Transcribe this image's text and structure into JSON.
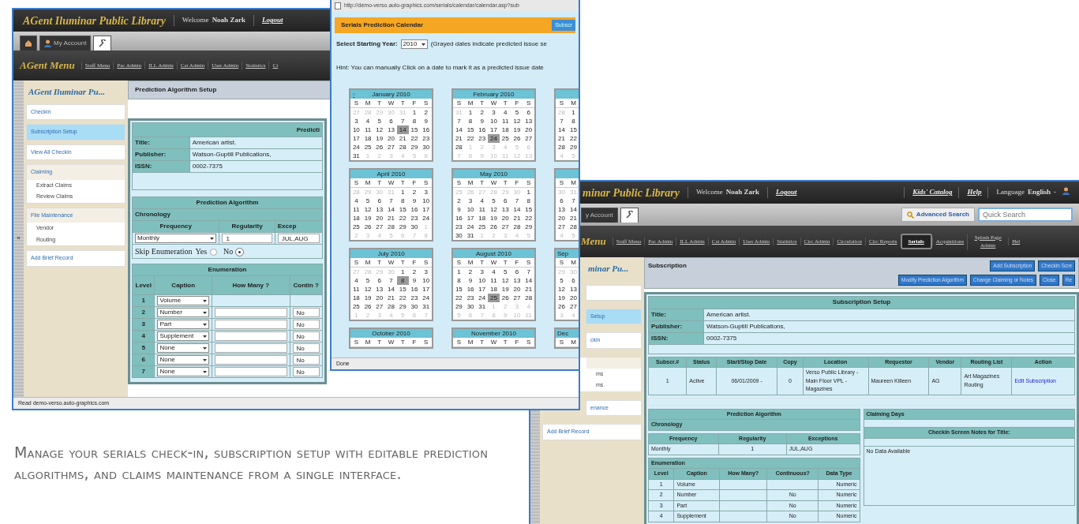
{
  "main_window": {
    "header": {
      "library": "AGent Iluminar Public Library",
      "welcome": "Welcome",
      "user": "Noah Zark",
      "logout": "Logout"
    },
    "tabs": [
      {
        "kind": "home",
        "selected": false
      },
      {
        "kind": "account",
        "label": "My Account",
        "selected": false
      },
      {
        "kind": "tools",
        "selected": true
      }
    ],
    "menu": {
      "title": "AGent Menu",
      "items": [
        "Staff Menu",
        "Pac Admin",
        "ILL Admin",
        "Cat Admin",
        "User Admin",
        "Statistics",
        "Ci"
      ]
    },
    "expand_arrow": "»",
    "sidebar": {
      "title": "AGent Iluminar Pu...",
      "items": [
        {
          "label": "Checkin",
          "selected": false
        },
        {
          "label": "Subscription Setup",
          "selected": true
        },
        {
          "label": "View All Checkin",
          "selected": false
        },
        {
          "label": "Claiming",
          "selected": false,
          "children": [
            "Extract Claims",
            "Review Claims"
          ]
        },
        {
          "label": "File Maintenance",
          "selected": false,
          "children": [
            "Vendor",
            "Routing"
          ]
        },
        {
          "label": "Add Brief Record",
          "selected": false
        }
      ]
    },
    "page_title": "Prediction Algorithm Setup",
    "title_table": {
      "heading": "Predicti",
      "rows": [
        {
          "label": "Title:",
          "value": "American artist."
        },
        {
          "label": "Publisher:",
          "value": "Watson-Guptill Publications,"
        },
        {
          "label": "ISSN:",
          "value": "0002-7375"
        }
      ]
    },
    "algorithm": {
      "heading": "Prediction Algorithm",
      "chronology": "Chronology",
      "columns": [
        "Frequency",
        "Regularity",
        "Excep"
      ],
      "frequency": "Monthly",
      "regularity": "1",
      "exceptions": "JUL,AUG",
      "skip_label": "Skip Enumeration",
      "options": [
        {
          "label": "Yes",
          "selected": false
        },
        {
          "label": "No",
          "selected": true
        }
      ]
    },
    "enumeration": {
      "heading": "Enumeration",
      "columns": [
        "Level",
        "Caption",
        "How Many ?",
        "Contin ?"
      ],
      "rows": [
        {
          "level": "1",
          "caption": "Volume"
        },
        {
          "level": "2",
          "caption": "Number",
          "continuous": "No"
        },
        {
          "level": "3",
          "caption": "Part",
          "continuous": "No"
        },
        {
          "level": "4",
          "caption": "Supplement",
          "continuous": "No"
        },
        {
          "level": "5",
          "caption": "None",
          "continuous": "No"
        },
        {
          "level": "6",
          "caption": "None",
          "continuous": "No"
        },
        {
          "level": "7",
          "caption": "None",
          "continuous": "No"
        }
      ]
    },
    "status": "Read demo-verso.auto-graphics.com"
  },
  "calendar_popup": {
    "url": "http://demo-verso.auto-graphics.com/serials/calendar/calendar.asp?sub",
    "title": "Serials Prediction Calendar",
    "title_button": "Subscr",
    "year_label": "Select Starting Year:",
    "year": "2010",
    "legend": "(Grayed dates indicate predicted issue se",
    "hint": "Hint: You can manually Click on a date to mark it as a predicted issue date",
    "months": [
      {
        "title": "January 2010",
        "prev": "‹",
        "weekdays": [
          "S",
          "M",
          "T",
          "W",
          "T",
          "F",
          "S"
        ],
        "lead": [
          "27",
          "28",
          "29",
          "30",
          "31"
        ],
        "days": [
          "1",
          "2",
          "3",
          "4",
          "5",
          "6",
          "7",
          "8",
          "9",
          "10",
          "11",
          "12",
          "13",
          {
            "day": "14",
            "marked": true
          },
          "15",
          "16",
          "17",
          "18",
          "19",
          "20",
          "21",
          "22",
          "23",
          "24",
          "25",
          "26",
          "27",
          "28",
          "29",
          "30",
          "31"
        ],
        "trail": [
          "1",
          "2",
          "3",
          "4",
          "5",
          "6"
        ]
      },
      {
        "title": "February 2010",
        "weekdays": [
          "S",
          "M",
          "T",
          "W",
          "T",
          "F",
          "S"
        ],
        "lead": [
          "31"
        ],
        "days": [
          "1",
          "2",
          "3",
          "4",
          "5",
          "6",
          "7",
          "8",
          "9",
          "10",
          "11",
          "12",
          "13",
          "14",
          "15",
          "16",
          "17",
          "18",
          "19",
          "20",
          "21",
          "22",
          "23",
          {
            "day": "24",
            "marked": true
          },
          "25",
          "26",
          "27",
          "28"
        ],
        "trail": [
          "1",
          "2",
          "3",
          "4",
          "5",
          "6",
          "7",
          "8",
          "9",
          "10",
          "11",
          "12",
          "13"
        ]
      },
      {
        "weekdays": [
          "S",
          "M"
        ],
        "lead": [
          "28"
        ],
        "days": [
          "1",
          "7",
          "8",
          "14",
          "15",
          "21",
          "22",
          "28",
          "29"
        ],
        "trail": [
          "4",
          "5"
        ]
      },
      {
        "title": "April 2010",
        "weekdays": [
          "S",
          "M",
          "T",
          "W",
          "T",
          "F",
          "S"
        ],
        "lead": [
          "28",
          "29",
          "30",
          "31"
        ],
        "days": [
          "1",
          "2",
          "3",
          "4",
          "5",
          "6",
          "7",
          "8",
          "9",
          "10",
          "11",
          "12",
          "13",
          "14",
          "15",
          "16",
          "17",
          "18",
          "19",
          "20",
          "21",
          "22",
          "23",
          "24",
          "25",
          "26",
          "27",
          "28",
          "29",
          "30"
        ],
        "trail": [
          "1",
          "2",
          "3",
          "4",
          "5",
          "6",
          "7",
          "8"
        ]
      },
      {
        "title": "May 2010",
        "weekdays": [
          "S",
          "M",
          "T",
          "W",
          "T",
          "F",
          "S"
        ],
        "lead": [
          "25",
          "26",
          "27",
          "28",
          "29",
          "30"
        ],
        "days": [
          "1",
          "2",
          "3",
          "4",
          "5",
          "6",
          "7",
          "8",
          "9",
          "10",
          "11",
          "12",
          "13",
          "14",
          "15",
          "16",
          "17",
          "18",
          "19",
          "20",
          "21",
          "22",
          "23",
          "24",
          "25",
          "26",
          "27",
          "28",
          "29",
          "30",
          "31"
        ],
        "trail": [
          "1",
          "2",
          "3",
          "4",
          "5"
        ]
      },
      {
        "weekdays": [
          "S",
          "M"
        ],
        "lead": [
          "30",
          "31"
        ],
        "days": [
          "6",
          "7",
          "13",
          "14",
          "20",
          "21",
          "27",
          "28"
        ],
        "trail": [
          "4",
          "5"
        ]
      },
      {
        "title": "July 2010",
        "weekdays": [
          "S",
          "M",
          "T",
          "W",
          "T",
          "F",
          "S"
        ],
        "lead": [
          "27",
          "28",
          "29",
          "30"
        ],
        "days": [
          "1",
          "2",
          "3",
          "4",
          "5",
          "6",
          "7",
          {
            "day": "8",
            "marked": true
          },
          "9",
          "10",
          "11",
          "12",
          "13",
          "14",
          "15",
          "16",
          "17",
          "18",
          "19",
          "20",
          "21",
          "22",
          "23",
          "24",
          "25",
          "26",
          "27",
          "28",
          "29",
          "30",
          "31"
        ],
        "trail": [
          "1",
          "2",
          "3",
          "4",
          "5",
          "6",
          "7"
        ]
      },
      {
        "title": "August 2010",
        "weekdays": [
          "S",
          "M",
          "T",
          "W",
          "T",
          "F",
          "S"
        ],
        "days": [
          "1",
          "2",
          "3",
          "4",
          "5",
          "6",
          "7",
          "8",
          "9",
          "10",
          "11",
          "12",
          "13",
          "14",
          "15",
          "16",
          "17",
          "18",
          "19",
          "20",
          "21",
          "22",
          "23",
          "24",
          {
            "day": "25",
            "marked": true
          },
          "26",
          "27",
          "28",
          "29",
          "30",
          "31"
        ],
        "trail": [
          "1",
          "2",
          "3",
          "4",
          "5",
          "6",
          "7",
          "8",
          "9",
          "10",
          "11"
        ]
      },
      {
        "title": "Sep",
        "weekdays": [
          "S",
          "M"
        ],
        "lead": [
          "29",
          "30"
        ],
        "days": [
          "5",
          "6",
          "12",
          "13",
          "19",
          "20",
          "26",
          "27"
        ],
        "trail": [
          "3",
          "4"
        ]
      },
      {
        "title": "October 2010",
        "weekdays": [
          "S",
          "M",
          "T",
          "W",
          "T",
          "F",
          "S"
        ]
      },
      {
        "title": "November 2010",
        "weekdays": [
          "S",
          "M",
          "T",
          "W",
          "T",
          "F",
          "S"
        ]
      },
      {
        "title": "Dec",
        "weekdays": [
          "S",
          "M"
        ]
      }
    ],
    "status": "Done"
  },
  "subscription_window": {
    "header": {
      "library": "minar Public Library",
      "welcome": "Welcome",
      "user": "Noah Zark",
      "logout": "Logout",
      "links": [
        "Kids' Catalog",
        "Help"
      ],
      "language_label": "Language",
      "language": "English",
      "language_caret": "-"
    },
    "account_tab": "y Account",
    "advanced_search": "Advanced Search",
    "quick_search": {
      "placeholder": "Quick Search"
    },
    "menu": {
      "title": "Menu",
      "items": [
        {
          "label": "Staff Menu",
          "selected": false
        },
        {
          "label": "Pac Admin",
          "selected": false
        },
        {
          "label": "ILL Admin",
          "selected": false
        },
        {
          "label": "Cat Admin",
          "selected": false
        },
        {
          "label": "User Admin",
          "selected": false
        },
        {
          "label": "Statistics",
          "selected": false
        },
        {
          "label": "Circ Admin",
          "selected": false
        },
        {
          "label": "Circulation",
          "selected": false
        },
        {
          "label": "Circ Reports",
          "selected": false
        },
        {
          "label": "Serials",
          "selected": true
        },
        {
          "label": "Acquisitions",
          "selected": false
        },
        {
          "label": "Splash Page Admin",
          "selected": false
        },
        {
          "label": "Hel",
          "selected": false
        }
      ]
    },
    "sidebar": {
      "title": "minar Pu...",
      "items": [
        {
          "selected": false
        },
        {
          "label": "Setup",
          "selected": true
        },
        {
          "label": "ckin",
          "selected": false
        },
        {
          "selected": false,
          "children": [
            "ms",
            "ms"
          ]
        },
        {
          "label": "enance",
          "selected": false
        }
      ],
      "footer_item": "Add Brief Record"
    },
    "page_title": "Subscription",
    "buttons": [
      "Add Subscription",
      "Checkin Scre"
    ],
    "buttons_row2": [
      "Modify Prediction Algorithm",
      "Change Claiming or Notes",
      "Close",
      "Re"
    ],
    "setup_table": {
      "heading": "Subscription Setup",
      "rows": [
        {
          "label": "Title:",
          "value": "American artist."
        },
        {
          "label": "Publisher:",
          "value": "Watson-Guptill Publications,"
        },
        {
          "label": "ISSN:",
          "value": "0002-7375"
        }
      ]
    },
    "subscriptions": {
      "columns": [
        "Subscr.#",
        "Status",
        "Start/Stop Date",
        "Copy",
        "Location",
        "Requestor",
        "Vendor",
        "Routing List",
        "Action"
      ],
      "rows": [
        {
          "number": "1",
          "status": "Active",
          "dates": "06/01/2009 -",
          "copy": "0",
          "location": "Verso Public Library - Main Floor VPL - Magazines",
          "requestor": "Maureen Killeen",
          "vendor": "AG",
          "routing": "Art Magazines Routing",
          "action": "Edit Subscription"
        }
      ]
    },
    "algorithm": {
      "heading": "Prediction Algorithm",
      "chronology": "Chronology",
      "columns": [
        "Frequency",
        "Regularity",
        "Exceptions"
      ],
      "frequency": "Monthly",
      "regularity": "1",
      "exceptions": "JUL,AUG",
      "enumeration": "Enumeration",
      "enum_columns": [
        "Level",
        "Caption",
        "How Many?",
        "Continuous?",
        "Data Type"
      ],
      "rows": [
        {
          "level": "1",
          "caption": "Volume",
          "type": "Numeric"
        },
        {
          "level": "2",
          "caption": "Number",
          "continuous": "No",
          "type": "Numeric"
        },
        {
          "level": "3",
          "caption": "Part",
          "continuous": "No",
          "type": "Numeric"
        },
        {
          "level": "4",
          "caption": "Supplement",
          "continuous": "No",
          "type": "Numeric"
        }
      ]
    },
    "claiming": {
      "heading": "Claiming Days",
      "notes_heading": "Checkin Screen Notes for Title:",
      "notes": "No Data Available"
    }
  },
  "caption": "Manage your serials check-in, subscription setup with editable prediction algorithms, and claims maintenance from a single interface."
}
